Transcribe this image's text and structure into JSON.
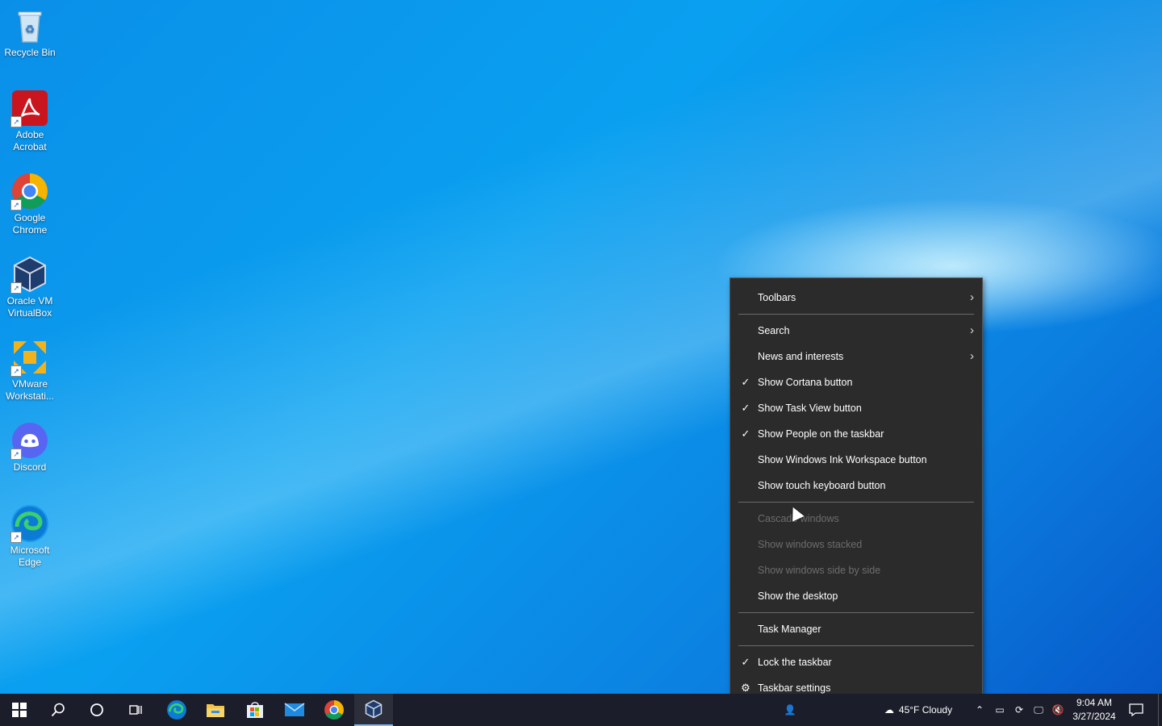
{
  "desktop": {
    "icons": [
      {
        "label": "Recycle Bin"
      },
      {
        "label": "Adobe Acrobat"
      },
      {
        "label": "Google Chrome"
      },
      {
        "label": "Oracle VM VirtualBox"
      },
      {
        "label": "VMware Workstati..."
      },
      {
        "label": "Discord"
      },
      {
        "label": "Microsoft Edge"
      }
    ]
  },
  "context_menu": {
    "items": [
      {
        "label": "Toolbars",
        "has_submenu": true
      },
      {
        "label": "Search",
        "has_submenu": true
      },
      {
        "label": "News and interests",
        "has_submenu": true
      },
      {
        "label": "Show Cortana button",
        "checked": true
      },
      {
        "label": "Show Task View button",
        "checked": true
      },
      {
        "label": "Show People on the taskbar",
        "checked": true
      },
      {
        "label": "Show Windows Ink Workspace button"
      },
      {
        "label": "Show touch keyboard button"
      },
      {
        "label": "Cascade windows",
        "disabled": true
      },
      {
        "label": "Show windows stacked",
        "disabled": true
      },
      {
        "label": "Show windows side by side",
        "disabled": true
      },
      {
        "label": "Show the desktop"
      },
      {
        "label": "Task Manager"
      },
      {
        "label": "Lock the taskbar",
        "checked": true
      },
      {
        "label": "Taskbar settings",
        "icon": "gear-icon"
      }
    ]
  },
  "taskbar": {
    "weather": "45°F Cloudy",
    "time": "9:04 AM",
    "date": "3/27/2024",
    "pinned": [
      "start-icon",
      "search-icon",
      "cortana-icon",
      "task-view-icon",
      "edge-icon",
      "file-explorer-icon",
      "store-icon",
      "mail-icon",
      "chrome-icon",
      "virtualbox-icon"
    ]
  },
  "colors": {
    "menu_bg": "#2b2b2b",
    "taskbar_bg": "#1b1d2a",
    "desktop_blue": "#0a8fe8"
  }
}
